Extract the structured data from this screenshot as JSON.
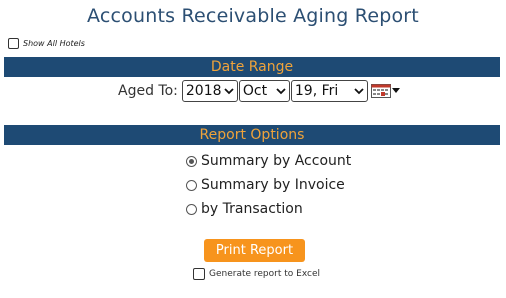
{
  "page": {
    "title": "Accounts Receivable Aging Report"
  },
  "filters": {
    "show_all_hotels_label": "Show All Hotels",
    "show_all_hotels_checked": false
  },
  "date_range": {
    "section_title": "Date Range",
    "aged_to_label": "Aged To:",
    "year": "2018",
    "month": "Oct",
    "day": "19, Fri",
    "calendar_icon": "calendar-icon"
  },
  "report_options": {
    "section_title": "Report Options",
    "options": [
      {
        "label": "Summary by Account",
        "selected": true
      },
      {
        "label": "Summary by Invoice",
        "selected": false
      },
      {
        "label": "by Transaction",
        "selected": false
      }
    ]
  },
  "actions": {
    "print_label": "Print Report",
    "excel_label": "Generate report to Excel",
    "excel_checked": false
  },
  "colors": {
    "title": "#2c4f73",
    "header_bar": "#1e4a74",
    "header_text": "#f0a33a",
    "button": "#f7941d"
  }
}
